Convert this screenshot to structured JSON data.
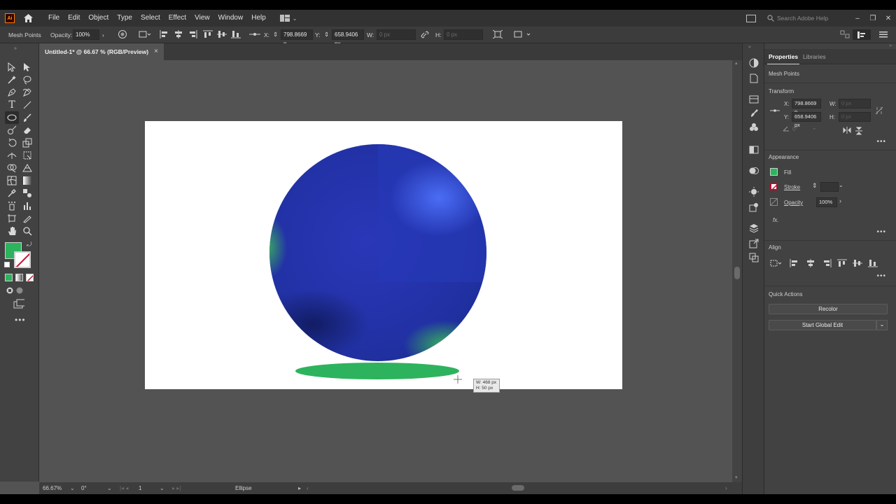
{
  "app": {
    "logo": "Ai"
  },
  "menu": [
    "File",
    "Edit",
    "Object",
    "Type",
    "Select",
    "Effect",
    "View",
    "Window",
    "Help"
  ],
  "search": {
    "placeholder": "Search Adobe Help"
  },
  "control_bar": {
    "selection_label": "Mesh Points",
    "opacity_label": "Opacity:",
    "opacity_value": "100%",
    "x_label": "X:",
    "x_value": "798.8669 p",
    "y_label": "Y:",
    "y_value": "658.9406 px",
    "w_label": "W:",
    "w_value": "0 px",
    "h_label": "H:",
    "h_value": "0 px"
  },
  "document": {
    "tab_title": "Untitled-1* @ 66.67 % (RGB/Preview)",
    "close": "×"
  },
  "canvas": {
    "size_tooltip_w": "W: 468 px",
    "size_tooltip_h": "H: 50 px"
  },
  "statusbar": {
    "zoom": "66.67%",
    "rotation": "0°",
    "artboard": "1",
    "tool": "Ellipse"
  },
  "properties": {
    "tabs": [
      "Properties",
      "Libraries"
    ],
    "selection": "Mesh Points",
    "transform": {
      "title": "Transform",
      "x_label": "X:",
      "x_value": "798.8669 p",
      "y_label": "Y:",
      "y_value": "658.9406 px",
      "w_label": "W:",
      "w_value": "0 px",
      "h_label": "H:",
      "h_value": "0 px",
      "angle_value": "0°"
    },
    "appearance": {
      "title": "Appearance",
      "fill_label": "Fill",
      "stroke_label": "Stroke",
      "opacity_label": "Opacity",
      "opacity_value": "100%",
      "fx_label": "fx."
    },
    "align": {
      "title": "Align"
    },
    "quick_actions": {
      "title": "Quick Actions",
      "recolor": "Recolor",
      "global_edit": "Start Global Edit"
    }
  },
  "colors": {
    "fill": "#2db35d",
    "sphere": "#2233aa",
    "shadow": "#2db35d",
    "accent": "#ff7c00"
  }
}
